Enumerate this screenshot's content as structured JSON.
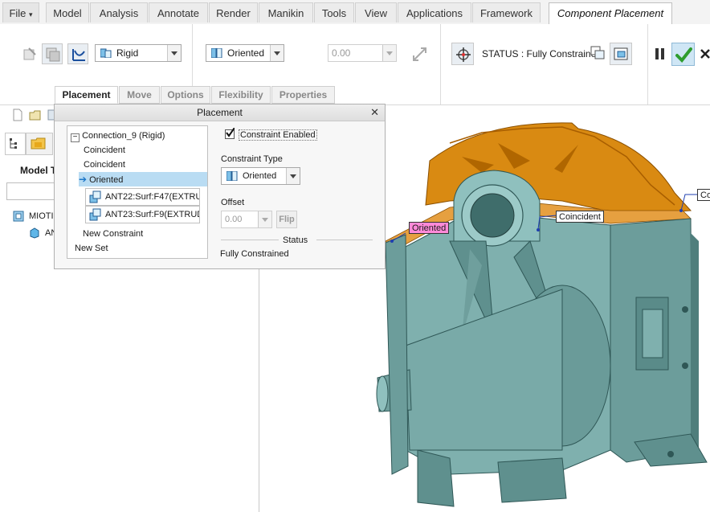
{
  "ribbon_tabs": [
    "File",
    "Model",
    "Analysis",
    "Annotate",
    "Render",
    "Manikin",
    "Tools",
    "View",
    "Applications",
    "Framework",
    "Component Placement"
  ],
  "ribbon": {
    "constraint_set_type": "Rigid",
    "constraint_type": "Oriented",
    "offset_value": "0.00",
    "status_text": "STATUS : Fully Constrained"
  },
  "dashboard_tabs": [
    "Placement",
    "Move",
    "Options",
    "Flexibility",
    "Properties"
  ],
  "panel": {
    "title": "Placement",
    "tree": {
      "connection": "Connection_9 (Rigid)",
      "constraints": [
        "Coincident",
        "Coincident",
        "Oriented"
      ],
      "references": [
        "ANT22:Surf:F47(EXTRU",
        "ANT23:Surf:F9(EXTRUD"
      ],
      "new_constraint": "New Constraint",
      "new_set": "New Set"
    },
    "constraint_enabled_label": "Constraint Enabled",
    "constraint_enabled": true,
    "constraint_type_label": "Constraint Type",
    "constraint_type_value": "Oriented",
    "offset_label": "Offset",
    "offset_value": "0.00",
    "flip_label": "Flip",
    "status_heading": "Status",
    "status_value": "Fully Constrained"
  },
  "left_panel": {
    "tree_header": "Model T",
    "items": [
      "MIOTIR",
      "ANT"
    ]
  },
  "viewport_labels": {
    "oriented": "Oriented",
    "coincident": "Coincident",
    "coincident_partial": "Co"
  },
  "colors": {
    "accent": "#b9dcf3",
    "model_teal": "#7fb0ae",
    "model_orange": "#d98a12",
    "ok_green": "#2e9d2e",
    "tag_pink": "#ff8ad8"
  }
}
